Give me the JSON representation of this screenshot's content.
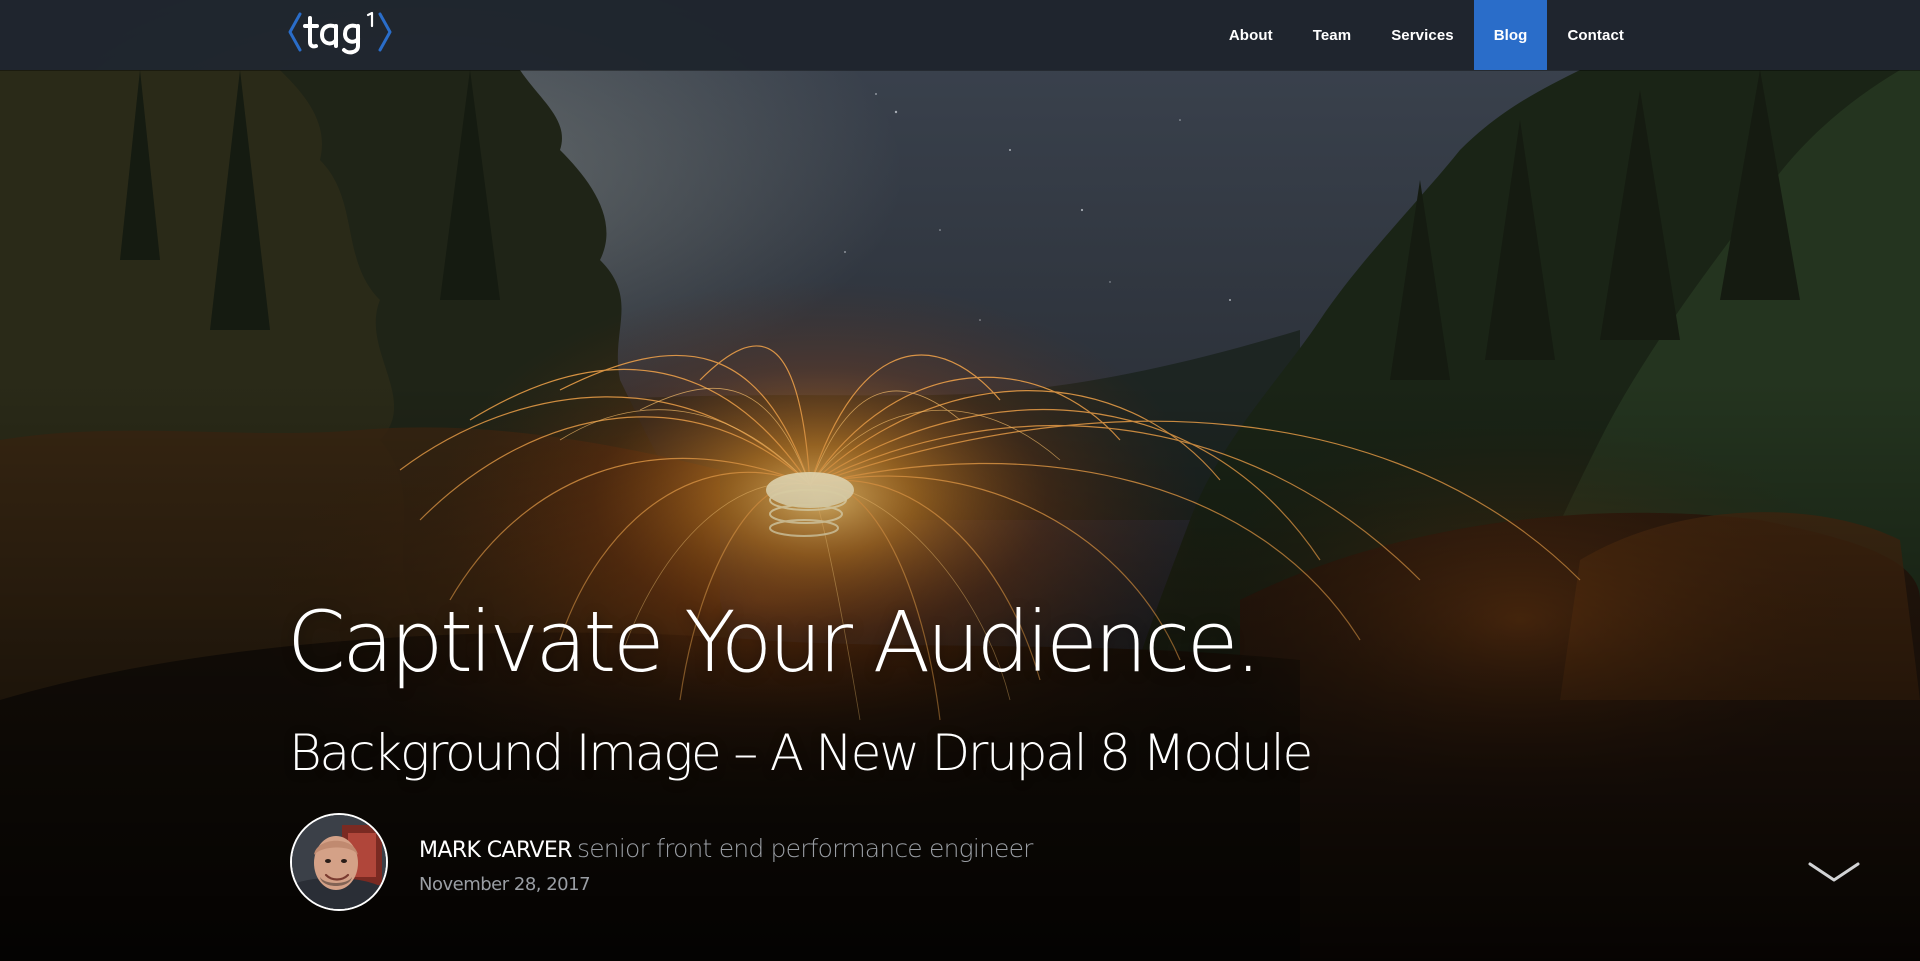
{
  "header": {
    "logo_alt": "tag1",
    "nav": [
      {
        "label": "About",
        "active": false
      },
      {
        "label": "Team",
        "active": false
      },
      {
        "label": "Services",
        "active": false
      },
      {
        "label": "Blog",
        "active": true
      },
      {
        "label": "Contact",
        "active": false
      }
    ]
  },
  "hero": {
    "title": "Captivate Your Audience.",
    "subtitle": "Background Image – A New Drupal 8 Module"
  },
  "author": {
    "name": "MARK CARVER",
    "role": "senior front end performance engineer",
    "date": "November 28, 2017"
  },
  "colors": {
    "accent": "#2a6dc9",
    "header_bg": "#1e242c",
    "muted_text": "#9a9ea4"
  },
  "icons": {
    "scroll": "chevron-down-icon",
    "logo": "tag1-logo-icon"
  }
}
